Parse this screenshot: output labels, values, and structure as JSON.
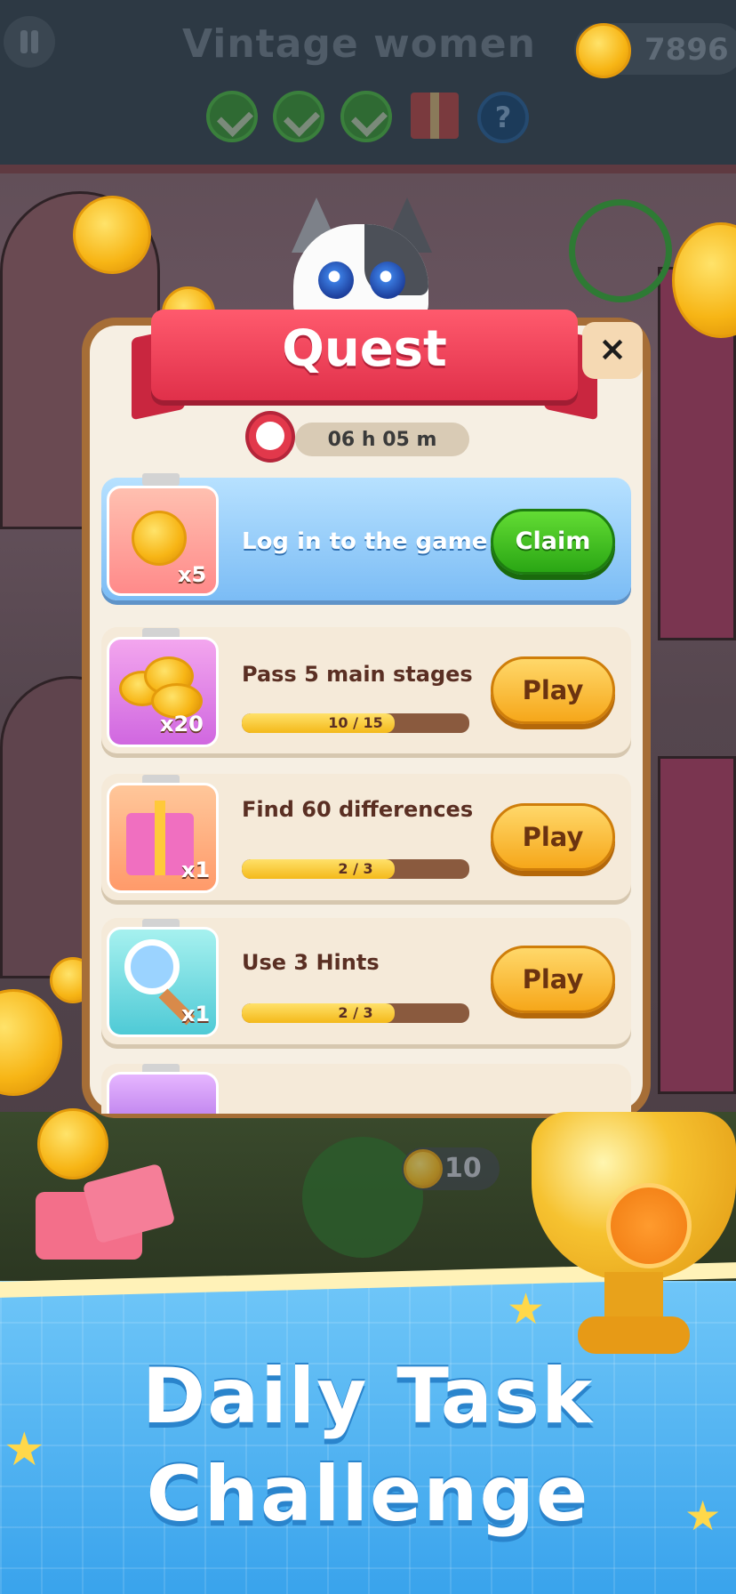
{
  "header": {
    "level_title": "Vintage women",
    "coin_count": "7896"
  },
  "quest": {
    "title": "Quest",
    "close_label": "×",
    "timer": "06 h 05 m",
    "tasks": [
      {
        "label": "Log in to the game",
        "reward_qty": "x5",
        "reward_icon": "coin-icon",
        "button": "Claim",
        "state": "claimable"
      },
      {
        "label": "Pass 5 main stages",
        "reward_qty": "x20",
        "reward_icon": "coin-pile-icon",
        "button": "Play",
        "progress_text": "10 / 15",
        "progress": 0.67
      },
      {
        "label": "Find 60 differences",
        "reward_qty": "x1",
        "reward_icon": "gift-icon",
        "button": "Play",
        "progress_text": "2 / 3",
        "progress": 0.67
      },
      {
        "label": "Use 3 Hints",
        "reward_qty": "x1",
        "reward_icon": "magnifier-icon",
        "button": "Play",
        "progress_text": "2 / 3",
        "progress": 0.67
      }
    ]
  },
  "hint_button": {
    "count": "10"
  },
  "banner": {
    "line1": "Daily Task",
    "line2": "Challenge"
  },
  "colors": {
    "ribbon": "#e0304a",
    "claim": "#2aa614",
    "play": "#f6a71a",
    "banner": "#39a3ec"
  }
}
